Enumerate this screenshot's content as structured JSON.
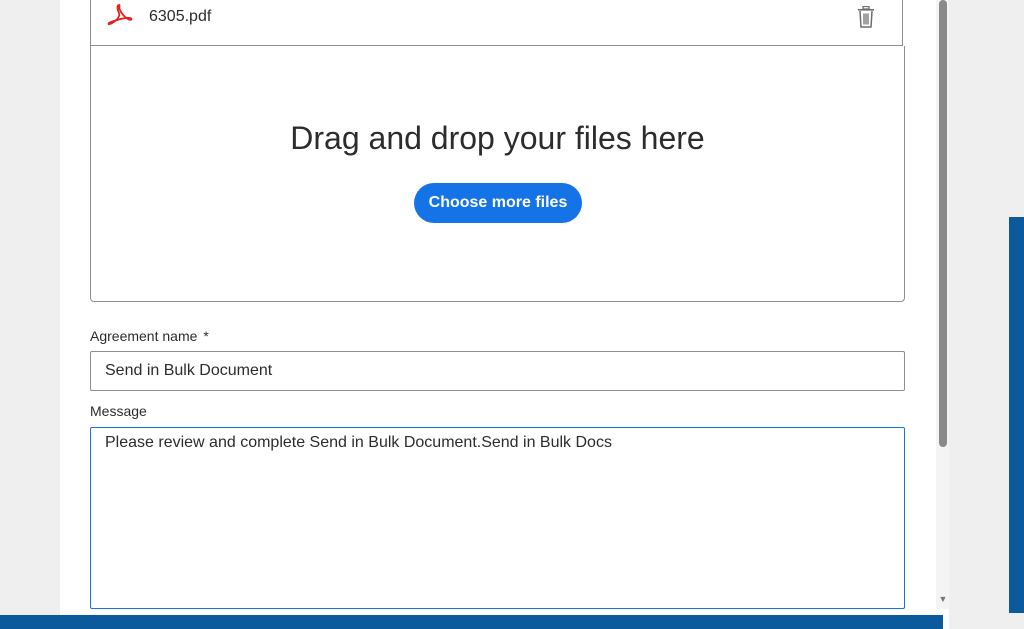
{
  "file": {
    "name": "6305.pdf",
    "type_icon": "pdf-icon",
    "delete_icon": "trash-icon"
  },
  "dropzone": {
    "title": "Drag and drop your files here",
    "button_label": "Choose more files"
  },
  "agreement_name": {
    "label": "Agreement name",
    "required_marker": "*",
    "value": "Send in Bulk Document"
  },
  "message": {
    "label": "Message",
    "value": "Please review and complete Send in Bulk Document.Send in Bulk Docs"
  },
  "colors": {
    "accent": "#1473e6",
    "pdf_red": "#e3231b",
    "frame_blue": "#0a5a9c"
  }
}
